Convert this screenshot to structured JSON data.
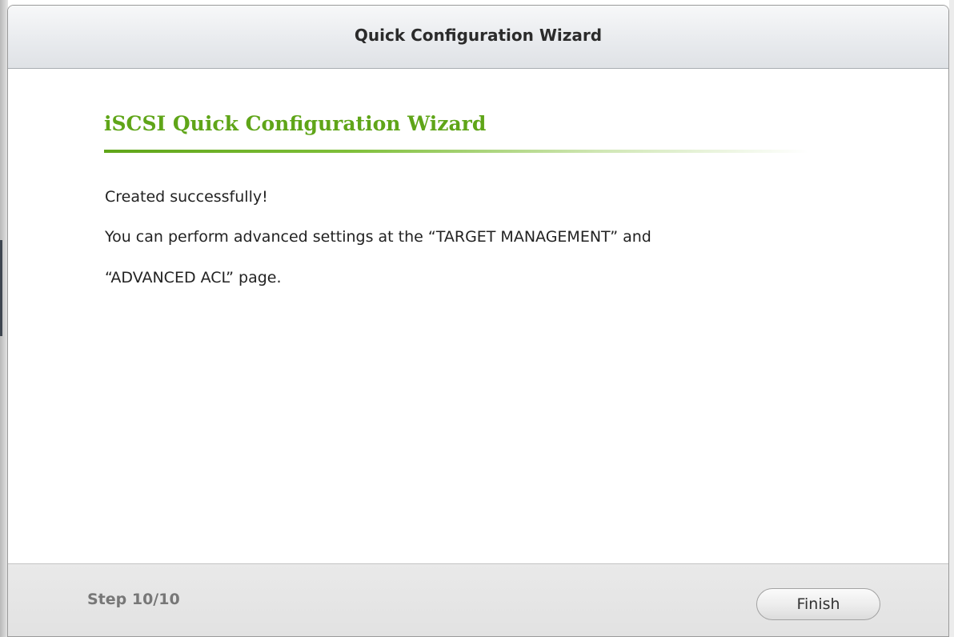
{
  "dialog": {
    "title": "Quick Configuration Wizard"
  },
  "content": {
    "heading": "iSCSI Quick Configuration Wizard",
    "heading_color": "#5fa518",
    "lines": [
      "Created successfully!",
      "You can perform advanced settings at the “TARGET MANAGEMENT” and",
      "“ADVANCED ACL” page."
    ]
  },
  "footer": {
    "step_label": "Step 10/10",
    "finish_label": "Finish"
  }
}
